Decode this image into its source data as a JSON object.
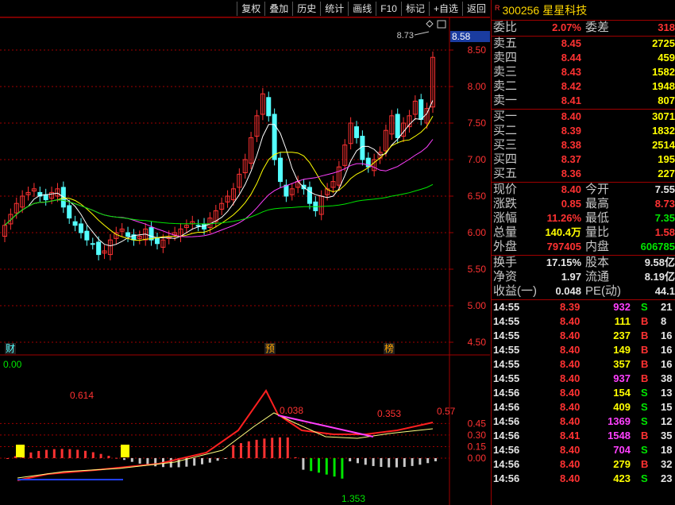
{
  "toolbar": {
    "buttons": [
      "复权",
      "叠加",
      "历史",
      "统计",
      "画线",
      "F10",
      "标记",
      "+自选",
      "返回"
    ]
  },
  "chart": {
    "price_axis": [
      "8.50",
      "8.00",
      "7.50",
      "7.00",
      "6.50",
      "6.00",
      "5.50",
      "5.00",
      "4.50"
    ],
    "current_price_tag": "8.58",
    "high_annotation": "8.73",
    "markers": [
      "财",
      "预",
      "榜"
    ],
    "indicator_value": "0.00",
    "indicator_axis": [
      "0.45",
      "0.30",
      "0.15",
      "0.00"
    ],
    "indicator_labels": [
      "0.614",
      "0.038",
      "0.353",
      "0.57",
      "1.353"
    ]
  },
  "quote": {
    "stock_flag": "R",
    "code": "300256",
    "name": "星星科技",
    "order_ratio_label": "委比",
    "order_ratio": "2.07%",
    "order_diff_label": "委差",
    "order_diff": "318",
    "asks": [
      {
        "label": "卖五",
        "price": "8.45",
        "vol": "2725"
      },
      {
        "label": "卖四",
        "price": "8.44",
        "vol": "459"
      },
      {
        "label": "卖三",
        "price": "8.43",
        "vol": "1582"
      },
      {
        "label": "卖二",
        "price": "8.42",
        "vol": "1948"
      },
      {
        "label": "卖一",
        "price": "8.41",
        "vol": "807"
      }
    ],
    "bids": [
      {
        "label": "买一",
        "price": "8.40",
        "vol": "3071"
      },
      {
        "label": "买二",
        "price": "8.39",
        "vol": "1832"
      },
      {
        "label": "买三",
        "price": "8.38",
        "vol": "2514"
      },
      {
        "label": "买四",
        "price": "8.37",
        "vol": "195"
      },
      {
        "label": "买五",
        "price": "8.36",
        "vol": "227"
      }
    ],
    "stats": [
      {
        "l1": "现价",
        "v1": "8.40",
        "c1": "red",
        "l2": "今开",
        "v2": "7.55",
        "c2": "wht"
      },
      {
        "l1": "涨跌",
        "v1": "0.85",
        "c1": "red",
        "l2": "最高",
        "v2": "8.73",
        "c2": "red"
      },
      {
        "l1": "涨幅",
        "v1": "11.26%",
        "c1": "red",
        "l2": "最低",
        "v2": "7.35",
        "c2": "grn"
      },
      {
        "l1": "总量",
        "v1": "140.4万",
        "c1": "yel",
        "l2": "量比",
        "v2": "1.58",
        "c2": "red"
      },
      {
        "l1": "外盘",
        "v1": "797405",
        "c1": "red",
        "l2": "内盘",
        "v2": "606785",
        "c2": "grn"
      }
    ],
    "fin": [
      {
        "l1": "换手",
        "v1": "17.15%",
        "l2": "股本",
        "v2": "9.58亿"
      },
      {
        "l1": "净资",
        "v1": "1.97",
        "l2": "流通",
        "v2": "8.19亿"
      },
      {
        "l1": "收益(一)",
        "v1": "0.048",
        "l2": "PE(动)",
        "v2": "44.1"
      }
    ],
    "ticks": [
      {
        "time": "14:55",
        "price": "8.39",
        "vol": "932",
        "vc": "mag",
        "bs": "S",
        "bc": "grn",
        "n": "21"
      },
      {
        "time": "14:55",
        "price": "8.40",
        "vol": "111",
        "vc": "yel",
        "bs": "B",
        "bc": "red",
        "n": "8"
      },
      {
        "time": "14:55",
        "price": "8.40",
        "vol": "237",
        "vc": "yel",
        "bs": "B",
        "bc": "red",
        "n": "16"
      },
      {
        "time": "14:55",
        "price": "8.40",
        "vol": "149",
        "vc": "yel",
        "bs": "B",
        "bc": "red",
        "n": "16"
      },
      {
        "time": "14:55",
        "price": "8.40",
        "vol": "357",
        "vc": "yel",
        "bs": "B",
        "bc": "red",
        "n": "16"
      },
      {
        "time": "14:55",
        "price": "8.40",
        "vol": "937",
        "vc": "mag",
        "bs": "B",
        "bc": "red",
        "n": "38"
      },
      {
        "time": "14:56",
        "price": "8.40",
        "vol": "154",
        "vc": "yel",
        "bs": "S",
        "bc": "grn",
        "n": "13"
      },
      {
        "time": "14:56",
        "price": "8.40",
        "vol": "409",
        "vc": "yel",
        "bs": "S",
        "bc": "grn",
        "n": "15"
      },
      {
        "time": "14:56",
        "price": "8.40",
        "vol": "1369",
        "vc": "mag",
        "bs": "S",
        "bc": "grn",
        "n": "12"
      },
      {
        "time": "14:56",
        "price": "8.41",
        "vol": "1548",
        "vc": "mag",
        "bs": "B",
        "bc": "red",
        "n": "35"
      },
      {
        "time": "14:56",
        "price": "8.40",
        "vol": "704",
        "vc": "mag",
        "bs": "S",
        "bc": "grn",
        "n": "18"
      },
      {
        "time": "14:56",
        "price": "8.40",
        "vol": "279",
        "vc": "yel",
        "bs": "B",
        "bc": "red",
        "n": "32"
      },
      {
        "time": "14:56",
        "price": "8.40",
        "vol": "423",
        "vc": "yel",
        "bs": "S",
        "bc": "grn",
        "n": "23"
      }
    ]
  },
  "colors": {
    "up": "#ff3232",
    "down": "#54ffff",
    "ma5": "#ffffff",
    "ma10": "#ffff00",
    "ma20": "#ff40ff",
    "ma60": "#00e600",
    "grid": "#a00000"
  }
}
